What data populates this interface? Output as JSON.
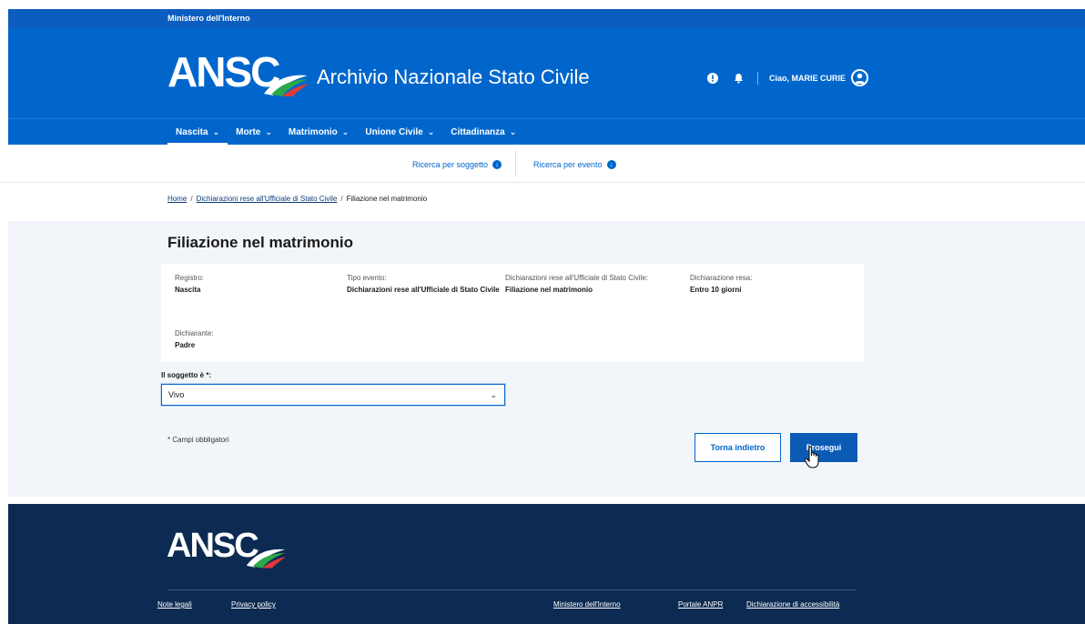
{
  "topbar": {
    "ministry": "Ministero dell'Interno"
  },
  "header": {
    "logo_text": "ANSC",
    "app_title": "Archivio Nazionale Stato Civile",
    "greeting": "Ciao, MARIE CURIE"
  },
  "nav": {
    "items": [
      {
        "label": "Nascita"
      },
      {
        "label": "Morte"
      },
      {
        "label": "Matrimonio"
      },
      {
        "label": "Unione Civile"
      },
      {
        "label": "Cittadinanza"
      }
    ]
  },
  "subnav": {
    "by_subject": "Ricerca per soggetto",
    "by_event": "Ricerca per evento"
  },
  "breadcrumb": {
    "home": "Home",
    "section": "Dichiarazioni rese all'Ufficiale di Stato Civile",
    "current": "Filiazione nel matrimonio"
  },
  "main": {
    "title": "Filiazione nel matrimonio",
    "fields": {
      "registro_label": "Registro:",
      "registro_value": "Nascita",
      "tipo_label": "Tipo evento:",
      "tipo_value": "Dichiarazioni rese all'Ufficiale di Stato Civile",
      "dich_label": "Dichiarazioni rese all'Ufficiale di Stato Civile:",
      "dich_value": "Filiazione nel matrimonio",
      "resa_label": "Dichiarazione resa:",
      "resa_value": "Entro 10 giorni",
      "dichiarante_label": "Dichiarante:",
      "dichiarante_value": "Padre"
    },
    "select_label": "Il soggetto è *:",
    "select_value": "Vivo",
    "required_note": "* Campi obbligatori",
    "back_button": "Torna indietro",
    "next_button": "Prosegui"
  },
  "footer": {
    "logo_text": "ANSC",
    "links": {
      "legal": "Note legali",
      "privacy": "Privacy policy",
      "ministry": "Ministero dell'Interno",
      "anpr": "Portale ANPR",
      "accessibility": "Dichiarazione di accessibilità"
    }
  },
  "colors": {
    "primary": "#0066cc",
    "topbar": "#0b5dc0",
    "footer": "#0d2b52",
    "main_bg": "#f2f6fb"
  }
}
